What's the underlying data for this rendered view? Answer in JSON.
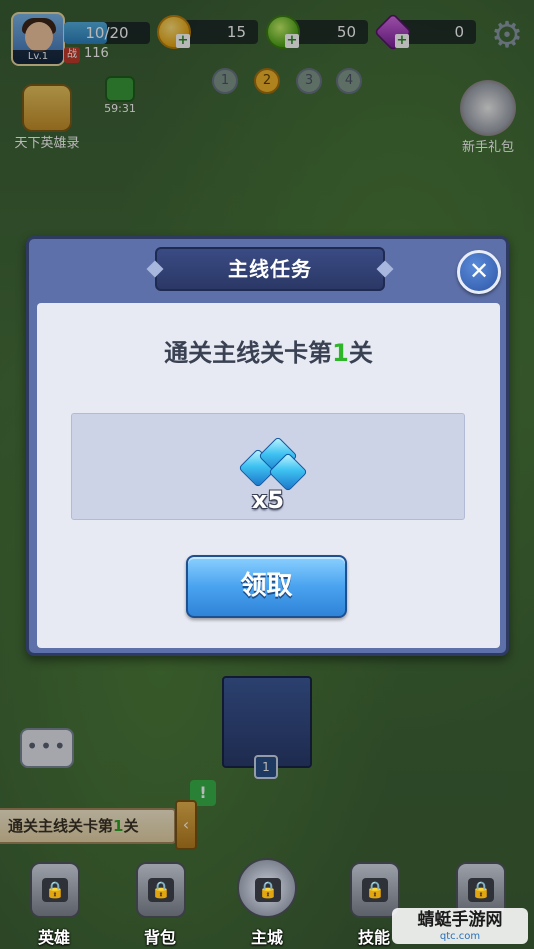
{
  "hud": {
    "level": "Lv.1",
    "energy": "10/20",
    "energy_fraction": 0.5,
    "power_badge": "战",
    "power": "116",
    "gold": "15",
    "green_currency": "50",
    "gems": "0",
    "plus": "+",
    "settings_icon": "gear-icon"
  },
  "pages": [
    "1",
    "2",
    "3",
    "4"
  ],
  "active_page": "2",
  "side": {
    "heroes_label": "天下英雄录",
    "timer": "59:31",
    "gift_label": "新手礼包"
  },
  "dialog": {
    "title": "主线任务",
    "close": "✕",
    "task_prefix": "通关主线关卡第",
    "task_num": "1",
    "task_suffix": "关",
    "reward_qty": "x5",
    "reward_icon": "gem-icon",
    "claim_label": "领取"
  },
  "scene": {
    "castle_level": "1",
    "chat": "•••",
    "quest_alert": "!",
    "quest_prefix": "通关主线关卡第",
    "quest_num": "1",
    "quest_suffix": "关",
    "quest_tab": "‹"
  },
  "nav": {
    "items": [
      {
        "label": "英雄"
      },
      {
        "label": "背包"
      },
      {
        "label": "主城"
      },
      {
        "label": "技能"
      },
      {
        "label": ""
      }
    ]
  },
  "watermark": {
    "name": "蜻蜓手游网",
    "url": "qtc.com"
  },
  "colors": {
    "dialog_frame": "#5d70a9",
    "claim_button": "#4aa3ef",
    "highlight_number": "#2fb52a"
  }
}
